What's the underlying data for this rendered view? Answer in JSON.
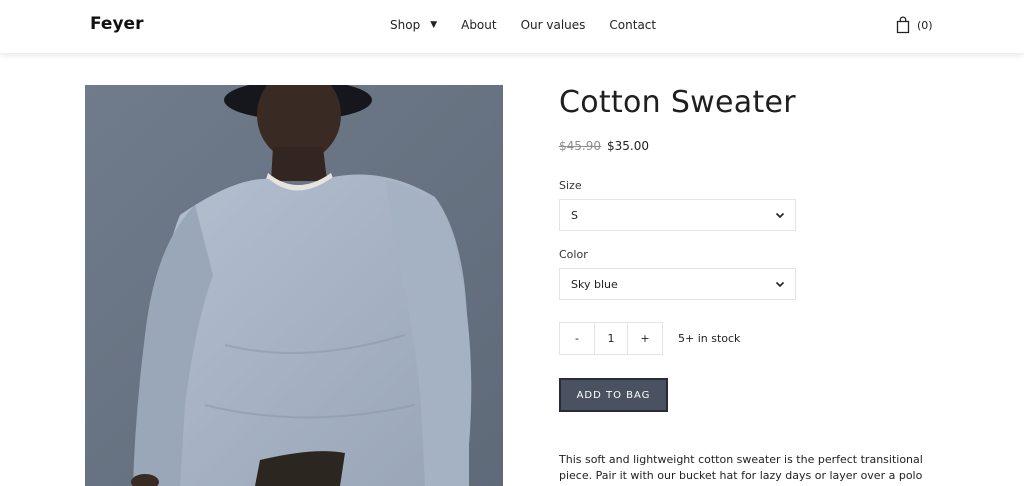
{
  "header": {
    "logo": "Feyer",
    "nav": {
      "shop": "Shop",
      "about": "About",
      "values": "Our values",
      "contact": "Contact"
    },
    "cart_count": "(0)"
  },
  "product": {
    "title": "Cotton Sweater",
    "price_old": "$45.90",
    "price_new": "$35.00",
    "size_label": "Size",
    "size_value": "S",
    "color_label": "Color",
    "color_value": "Sky blue",
    "qty_minus": "-",
    "qty_value": "1",
    "qty_plus": "+",
    "stock": "5+ in stock",
    "add_button": "ADD TO BAG",
    "description": "This soft and lightweight cotton sweater is the perfect transitional piece. Pair it with our bucket hat for lazy days or layer over a polo shirt."
  },
  "colors": {
    "button_bg": "#4a5262",
    "button_border": "#272c36",
    "sweater": "#a9b5c6",
    "background_photo": "#6b7685"
  },
  "icons": {
    "cart": "shopping-bag-icon",
    "caret": "caret-down-icon",
    "select_chevron": "chevron-down-icon"
  }
}
